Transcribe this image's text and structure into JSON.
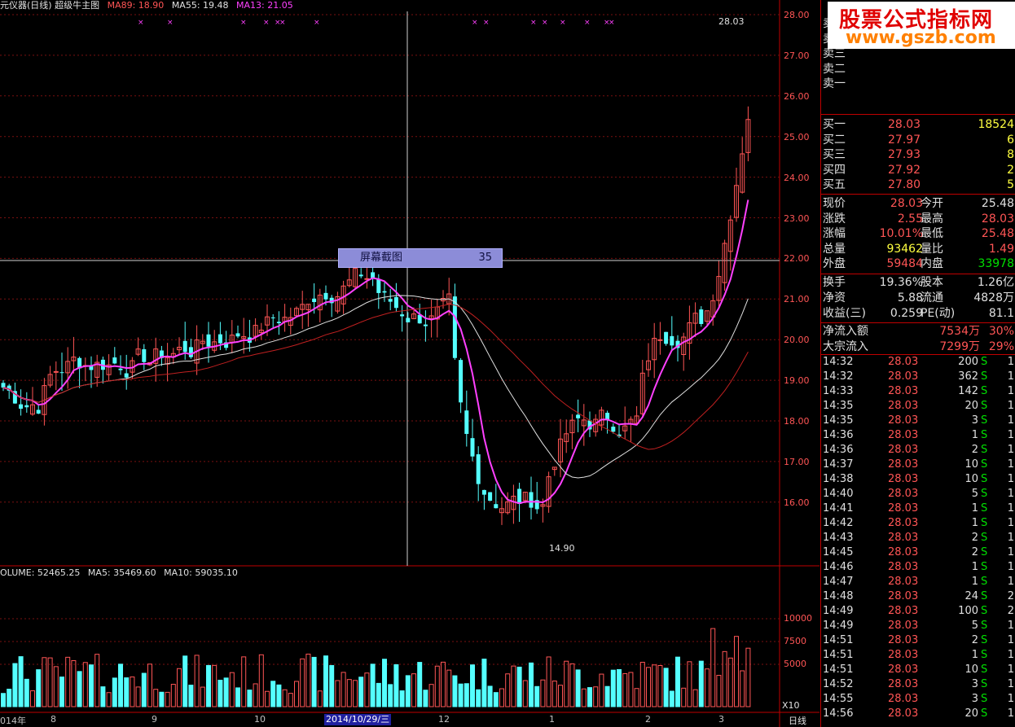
{
  "header": {
    "title": "元仪器(日线) 超级牛主图",
    "ma89": "MA89: 18.90",
    "ma55": "MA55: 19.48",
    "ma13": "MA13: 21.05"
  },
  "volume_header": {
    "volume": "OLUME: 52465.25",
    "ma5": "MA5: 35469.60",
    "ma10": "MA10: 59035.10"
  },
  "popup": {
    "label": "屏幕截图",
    "value": "35"
  },
  "annotations": {
    "high": "28.03",
    "low": "14.90"
  },
  "price_axis": [
    "28.00",
    "27.00",
    "26.00",
    "25.00",
    "24.00",
    "23.00",
    "22.00",
    "21.00",
    "20.00",
    "19.00",
    "18.00",
    "17.00",
    "16.00"
  ],
  "volume_axis": [
    "10000",
    "7500",
    "5000"
  ],
  "volume_unit": "X10",
  "x_axis": {
    "labels": [
      "014年",
      "8",
      "9",
      "10",
      "12",
      "1",
      "2",
      "3"
    ],
    "selected_date": "2014/10/29/三",
    "period": "日线"
  },
  "watermark": {
    "line1": "股票公式指标网",
    "line2": "www.gszb.com"
  },
  "order_book": {
    "asks": [
      {
        "label": "卖五",
        "price": "",
        "vol": ""
      },
      {
        "label": "卖四",
        "price": "",
        "vol": ""
      },
      {
        "label": "卖三",
        "price": "",
        "vol": ""
      },
      {
        "label": "卖二",
        "price": "",
        "vol": ""
      },
      {
        "label": "卖一",
        "price": "",
        "vol": ""
      }
    ],
    "bids": [
      {
        "label": "买一",
        "price": "28.03",
        "vol": "18524"
      },
      {
        "label": "买二",
        "price": "27.97",
        "vol": "6"
      },
      {
        "label": "买三",
        "price": "27.93",
        "vol": "8"
      },
      {
        "label": "买四",
        "price": "27.92",
        "vol": "2"
      },
      {
        "label": "买五",
        "price": "27.80",
        "vol": "5"
      }
    ]
  },
  "quote": [
    {
      "l1": "现价",
      "v1": "28.03",
      "l2": "今开",
      "v2": "25.48"
    },
    {
      "l1": "涨跌",
      "v1": "2.55",
      "l2": "最高",
      "v2": "28.03"
    },
    {
      "l1": "涨幅",
      "v1": "10.01%",
      "l2": "最低",
      "v2": "25.48"
    },
    {
      "l1": "总量",
      "v1": "93462",
      "l2": "量比",
      "v2": "1.49"
    },
    {
      "l1": "外盘",
      "v1": "59484",
      "l2": "内盘",
      "v2": "33978"
    }
  ],
  "fundamentals": [
    {
      "l1": "换手",
      "v1": "19.36%",
      "l2": "股本",
      "v2": "1.26亿"
    },
    {
      "l1": "净资",
      "v1": "5.88",
      "l2": "流通",
      "v2": "4828万"
    },
    {
      "l1": "收益(三)",
      "v1": "0.259",
      "l2": "PE(动)",
      "v2": "81.1"
    }
  ],
  "flows": [
    {
      "label": "净流入额",
      "value": "7534万",
      "pct": "30%"
    },
    {
      "label": "大宗流入",
      "value": "7299万",
      "pct": "29%"
    }
  ],
  "ticks": [
    {
      "time": "14:32",
      "price": "28.03",
      "vol": "200",
      "side": "S",
      "n": "1"
    },
    {
      "time": "14:32",
      "price": "28.03",
      "vol": "362",
      "side": "S",
      "n": "1"
    },
    {
      "time": "14:33",
      "price": "28.03",
      "vol": "142",
      "side": "S",
      "n": "1"
    },
    {
      "time": "14:35",
      "price": "28.03",
      "vol": "20",
      "side": "S",
      "n": "1"
    },
    {
      "time": "14:35",
      "price": "28.03",
      "vol": "3",
      "side": "S",
      "n": "1"
    },
    {
      "time": "14:36",
      "price": "28.03",
      "vol": "1",
      "side": "S",
      "n": "1"
    },
    {
      "time": "14:36",
      "price": "28.03",
      "vol": "2",
      "side": "S",
      "n": "1"
    },
    {
      "time": "14:37",
      "price": "28.03",
      "vol": "10",
      "side": "S",
      "n": "1"
    },
    {
      "time": "14:38",
      "price": "28.03",
      "vol": "10",
      "side": "S",
      "n": "1"
    },
    {
      "time": "14:40",
      "price": "28.03",
      "vol": "5",
      "side": "S",
      "n": "1"
    },
    {
      "time": "14:41",
      "price": "28.03",
      "vol": "1",
      "side": "S",
      "n": "1"
    },
    {
      "time": "14:42",
      "price": "28.03",
      "vol": "1",
      "side": "S",
      "n": "1"
    },
    {
      "time": "14:43",
      "price": "28.03",
      "vol": "2",
      "side": "S",
      "n": "1"
    },
    {
      "time": "14:45",
      "price": "28.03",
      "vol": "2",
      "side": "S",
      "n": "1"
    },
    {
      "time": "14:46",
      "price": "28.03",
      "vol": "1",
      "side": "S",
      "n": "1"
    },
    {
      "time": "14:47",
      "price": "28.03",
      "vol": "1",
      "side": "S",
      "n": "1"
    },
    {
      "time": "14:48",
      "price": "28.03",
      "vol": "24",
      "side": "S",
      "n": "2"
    },
    {
      "time": "14:49",
      "price": "28.03",
      "vol": "100",
      "side": "S",
      "n": "2"
    },
    {
      "time": "14:49",
      "price": "28.03",
      "vol": "5",
      "side": "S",
      "n": "1"
    },
    {
      "time": "14:51",
      "price": "28.03",
      "vol": "2",
      "side": "S",
      "n": "1"
    },
    {
      "time": "14:51",
      "price": "28.03",
      "vol": "1",
      "side": "S",
      "n": "1"
    },
    {
      "time": "14:51",
      "price": "28.03",
      "vol": "10",
      "side": "S",
      "n": "1"
    },
    {
      "time": "14:52",
      "price": "28.03",
      "vol": "3",
      "side": "S",
      "n": "1"
    },
    {
      "time": "14:55",
      "price": "28.03",
      "vol": "3",
      "side": "S",
      "n": "1"
    },
    {
      "time": "14:56",
      "price": "28.03",
      "vol": "20",
      "side": "S",
      "n": "1"
    }
  ],
  "colors": {
    "up": "#ff5555",
    "down": "#54ffff",
    "ma13": "#ff40ff",
    "ma55": "#e0e0e0",
    "ma89": "#c02020",
    "border": "#c00000"
  }
}
